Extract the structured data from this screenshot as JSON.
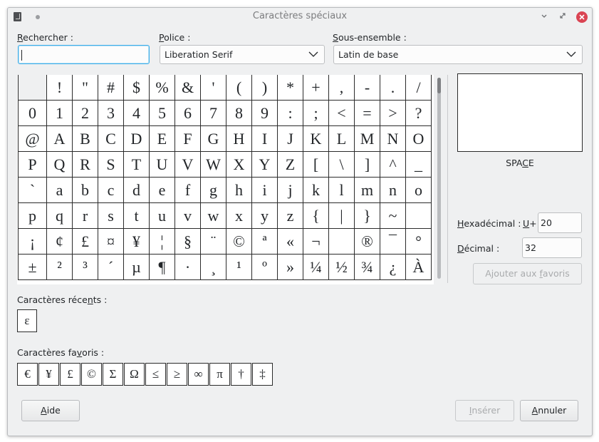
{
  "window": {
    "title": "Caractères spéciaux"
  },
  "search": {
    "label_pre": "",
    "label_u": "R",
    "label_post": "echercher :",
    "value": ""
  },
  "font": {
    "label_pre": "",
    "label_u": "P",
    "label_post": "olice :",
    "value": "Liberation Serif"
  },
  "subset": {
    "label_pre": "",
    "label_u": "S",
    "label_post": "ous-ensemble :",
    "value": "Latin de base"
  },
  "grid": {
    "rows": [
      [
        " ",
        "!",
        "\"",
        "#",
        "$",
        "%",
        "&",
        "'",
        "(",
        ")",
        "*",
        "+",
        ",",
        "-",
        ".",
        "/"
      ],
      [
        "0",
        "1",
        "2",
        "3",
        "4",
        "5",
        "6",
        "7",
        "8",
        "9",
        ":",
        ";",
        "<",
        "=",
        ">",
        "?"
      ],
      [
        "@",
        "A",
        "B",
        "C",
        "D",
        "E",
        "F",
        "G",
        "H",
        "I",
        "J",
        "K",
        "L",
        "M",
        "N",
        "O"
      ],
      [
        "P",
        "Q",
        "R",
        "S",
        "T",
        "U",
        "V",
        "W",
        "X",
        "Y",
        "Z",
        "[",
        "\\",
        "]",
        "^",
        "_"
      ],
      [
        "`",
        "a",
        "b",
        "c",
        "d",
        "e",
        "f",
        "g",
        "h",
        "i",
        "j",
        "k",
        "l",
        "m",
        "n",
        "o"
      ],
      [
        "p",
        "q",
        "r",
        "s",
        "t",
        "u",
        "v",
        "w",
        "x",
        "y",
        "z",
        "{",
        "|",
        "}",
        "~",
        " "
      ],
      [
        "¡",
        "¢",
        "£",
        "¤",
        "¥",
        "¦",
        "§",
        "¨",
        "©",
        "ª",
        "«",
        "¬",
        " ",
        "®",
        "¯",
        "°"
      ],
      [
        "±",
        "²",
        "³",
        "´",
        "µ",
        "¶",
        "·",
        "¸",
        "¹",
        "º",
        "»",
        "¼",
        "½",
        "¾",
        "¿",
        "À"
      ]
    ]
  },
  "preview": {
    "char_name_pre": "SPA",
    "char_name_u": "C",
    "char_name_post": "E"
  },
  "hex": {
    "label_pre": "",
    "label_u": "H",
    "label_post": "exadécimal :",
    "prefix_u": "U",
    "prefix_post": "+",
    "value": "20"
  },
  "decimal": {
    "label_pre": "",
    "label_u": "D",
    "label_post": "écimal :",
    "value": "32"
  },
  "buttons": {
    "add_favorite_pre": "Ajouter aux ",
    "add_favorite_u": "f",
    "add_favorite_post": "avoris",
    "help_pre": "",
    "help_u": "A",
    "help_post": "ide",
    "insert_pre": "",
    "insert_u": "I",
    "insert_post": "nsérer",
    "cancel_pre": "",
    "cancel_u": "A",
    "cancel_post": "nnuler"
  },
  "recent": {
    "label_pre": "Caractères réce",
    "label_u": "n",
    "label_post": "ts :",
    "chars": [
      "ε"
    ]
  },
  "favorites": {
    "label_pre": "Caractères fa",
    "label_u": "v",
    "label_post": "oris :",
    "chars": [
      "€",
      "¥",
      "£",
      "©",
      "Σ",
      "Ω",
      "≤",
      "≥",
      "∞",
      "π",
      "†",
      "‡"
    ]
  }
}
